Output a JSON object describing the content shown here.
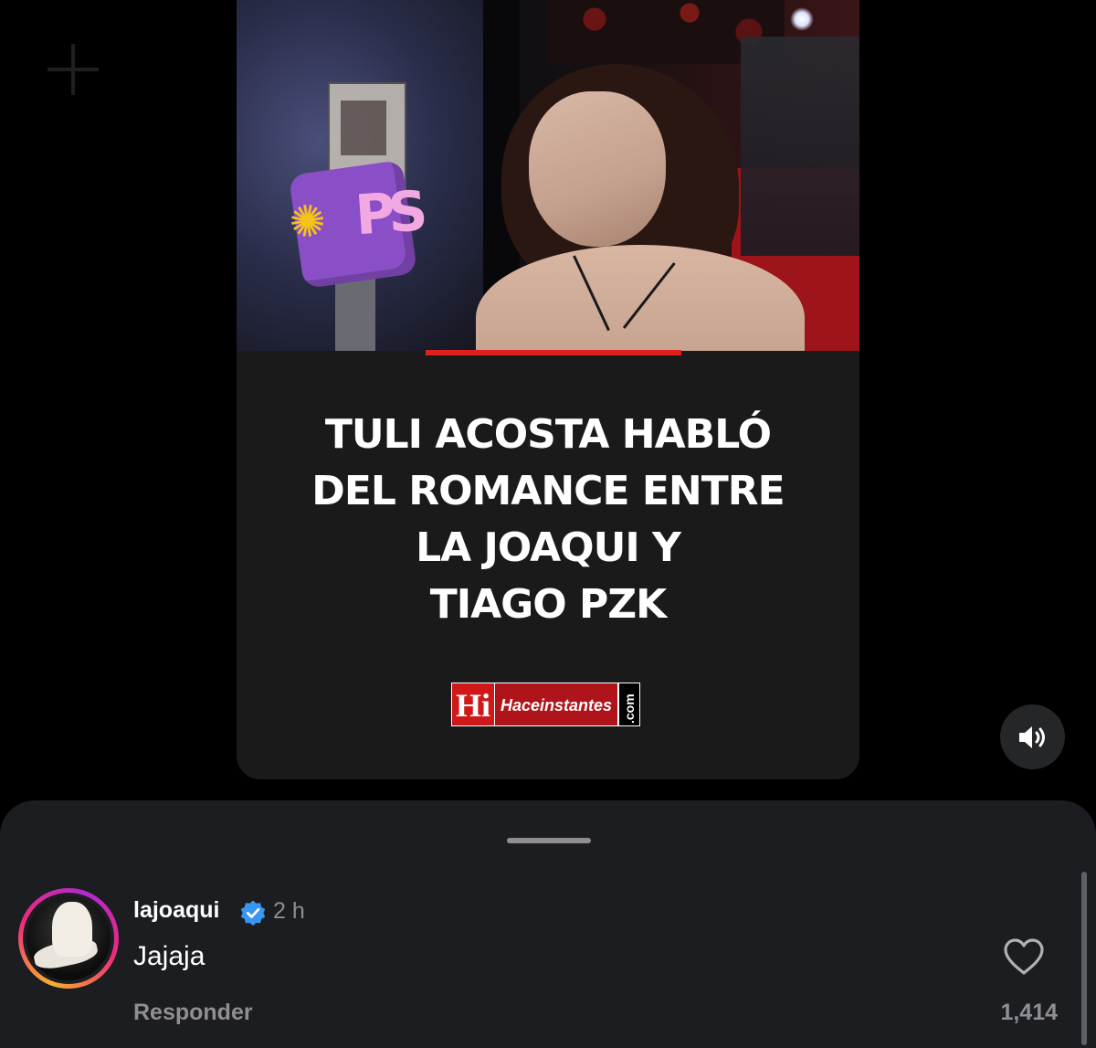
{
  "post": {
    "headline_lines": [
      "TULI ACOSTA HABLÓ",
      "DEL ROMANCE ENTRE",
      "LA JOAQUI Y",
      "TIAGO PZK"
    ],
    "brand": {
      "mark": "Hi",
      "name": "Haceinstantes",
      "tld": ".com"
    },
    "video_progress": 0.41,
    "sound_icon": "speaker-icon"
  },
  "comments": {
    "items": [
      {
        "username": "lajoaqui",
        "verified": true,
        "time": "2 h",
        "text": "Jajaja",
        "reply_label": "Responder",
        "likes": "1,414"
      }
    ]
  },
  "colors": {
    "background": "#000000",
    "sheet": "#1c1d20",
    "muted_text": "#8e8e93",
    "verified_blue": "#3897f0",
    "accent_red": "#e0201f"
  }
}
